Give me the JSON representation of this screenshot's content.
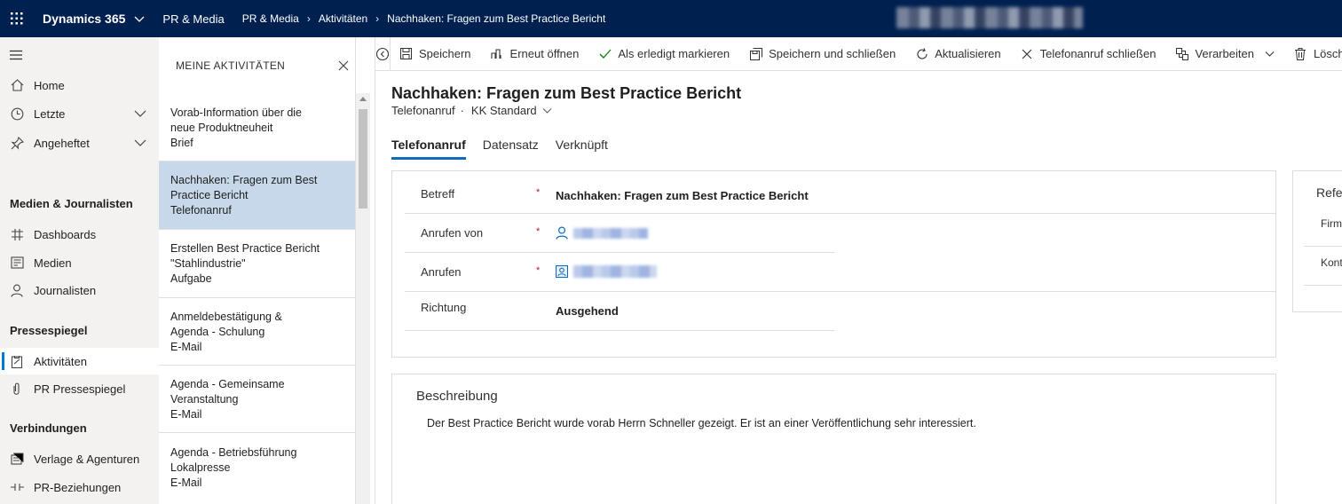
{
  "topbar": {
    "app_name": "Dynamics 365",
    "area": "PR & Media",
    "breadcrumb": [
      "PR & Media",
      "Aktivitäten",
      "Nachhaken: Fragen zum Best Practice Bericht"
    ]
  },
  "nav": {
    "items_top": [
      {
        "label": "Home",
        "icon": "home-icon"
      },
      {
        "label": "Letzte",
        "icon": "clock-icon",
        "expandable": true
      },
      {
        "label": "Angeheftet",
        "icon": "pin-icon",
        "expandable": true
      }
    ],
    "group1": {
      "title": "Medien & Journalisten",
      "items": [
        {
          "label": "Dashboards",
          "icon": "dashboard-icon"
        },
        {
          "label": "Medien",
          "icon": "newspaper-icon"
        },
        {
          "label": "Journalisten",
          "icon": "person-icon"
        }
      ]
    },
    "group2": {
      "title": "Pressespiegel",
      "items": [
        {
          "label": "Aktivitäten",
          "icon": "clipboard-icon",
          "active": true
        },
        {
          "label": "PR Pressespiegel",
          "icon": "attachment-icon"
        }
      ]
    },
    "group3": {
      "title": "Verbindungen",
      "items": [
        {
          "label": "Verlage & Agenturen",
          "icon": "building-icon"
        },
        {
          "label": "PR-Beziehungen",
          "icon": "connection-icon"
        }
      ]
    }
  },
  "activity_list": {
    "title": "MEINE AKTIVITÄTEN",
    "items": [
      {
        "lines": [
          "Vorab-Information über die",
          "neue Produktneuheit",
          "Brief"
        ]
      },
      {
        "lines": [
          "Nachhaken: Fragen zum Best",
          "Practice Bericht",
          "Telefonanruf"
        ],
        "selected": true
      },
      {
        "lines": [
          "Erstellen Best Practice Bericht",
          "\"Stahlindustrie\"",
          "Aufgabe"
        ]
      },
      {
        "lines": [
          "Anmeldebestätigung &",
          "Agenda - Schulung",
          "E-Mail"
        ]
      },
      {
        "lines": [
          "Agenda - Gemeinsame",
          "Veranstaltung",
          "E-Mail"
        ]
      },
      {
        "lines": [
          "Agenda - Betriebsführung",
          "Lokalpresse",
          "E-Mail"
        ]
      }
    ]
  },
  "commands": {
    "save": "Speichern",
    "reopen": "Erneut öffnen",
    "mark_complete": "Als erledigt markieren",
    "save_close": "Speichern und schließen",
    "refresh": "Aktualisieren",
    "close_call": "Telefonanruf schließen",
    "process": "Verarbeiten",
    "delete": "Löschen"
  },
  "form": {
    "title": "Nachhaken: Fragen zum Best Practice Bericht",
    "entity": "Telefonanruf",
    "form_name": "KK Standard",
    "tabs": [
      "Telefonanruf",
      "Datensatz",
      "Verknüpft"
    ],
    "fields": {
      "subject": {
        "label": "Betreff",
        "value": "Nachhaken: Fragen zum Best Practice Bericht",
        "required": "*"
      },
      "from": {
        "label": "Anrufen von",
        "required": "*"
      },
      "to": {
        "label": "Anrufen",
        "required": "*"
      },
      "direction": {
        "label": "Richtung",
        "value": "Ausgehend"
      }
    },
    "description": {
      "title": "Beschreibung",
      "text": "Der Best Practice Bericht wurde vorab Herrn Schneller gezeigt. Er ist an einer Veröffentlichung sehr interessiert."
    },
    "side_panel": {
      "title": "Refe",
      "labels": [
        "Firm",
        "Kont"
      ]
    }
  }
}
